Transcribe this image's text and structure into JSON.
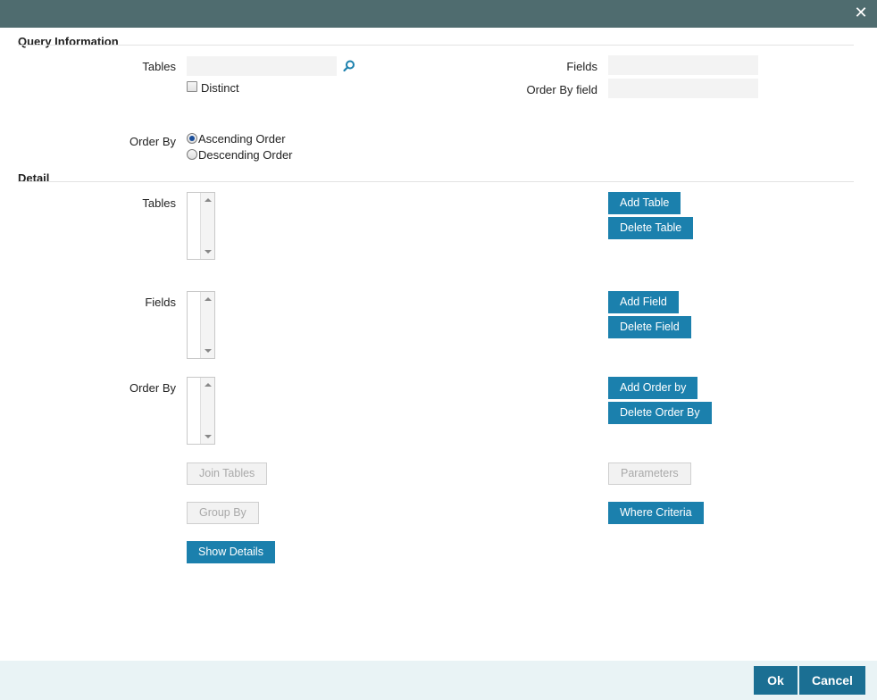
{
  "window": {
    "close_glyph": "✕"
  },
  "query_info": {
    "title": "Query Information",
    "tables_label": "Tables",
    "tables_value": "",
    "distinct_label": "Distinct",
    "distinct_checked": false,
    "fields_label": "Fields",
    "fields_value": "",
    "order_by_field_label": "Order By field",
    "order_by_field_value": "",
    "order_by_label": "Order By",
    "ascending_label": "Ascending Order",
    "descending_label": "Descending Order",
    "selected_order": "ascending"
  },
  "detail": {
    "title": "Detail",
    "tables_label": "Tables",
    "fields_label": "Fields",
    "order_by_label": "Order By",
    "add_table": "Add Table",
    "delete_table": "Delete Table",
    "add_field": "Add Field",
    "delete_field": "Delete Field",
    "add_order_by": "Add Order by",
    "delete_order_by": "Delete Order By",
    "join_tables": "Join Tables",
    "parameters": "Parameters",
    "group_by": "Group By",
    "where_criteria": "Where Criteria",
    "show_details": "Show Details"
  },
  "footer": {
    "ok": "Ok",
    "cancel": "Cancel"
  },
  "colors": {
    "titlebar": "#4f6c6f",
    "button": "#1b80ad",
    "footer": "#e9f3f5",
    "footer_button": "#1b6f93"
  },
  "icons": {
    "lookup": "magnifier-icon",
    "close": "close-icon"
  }
}
